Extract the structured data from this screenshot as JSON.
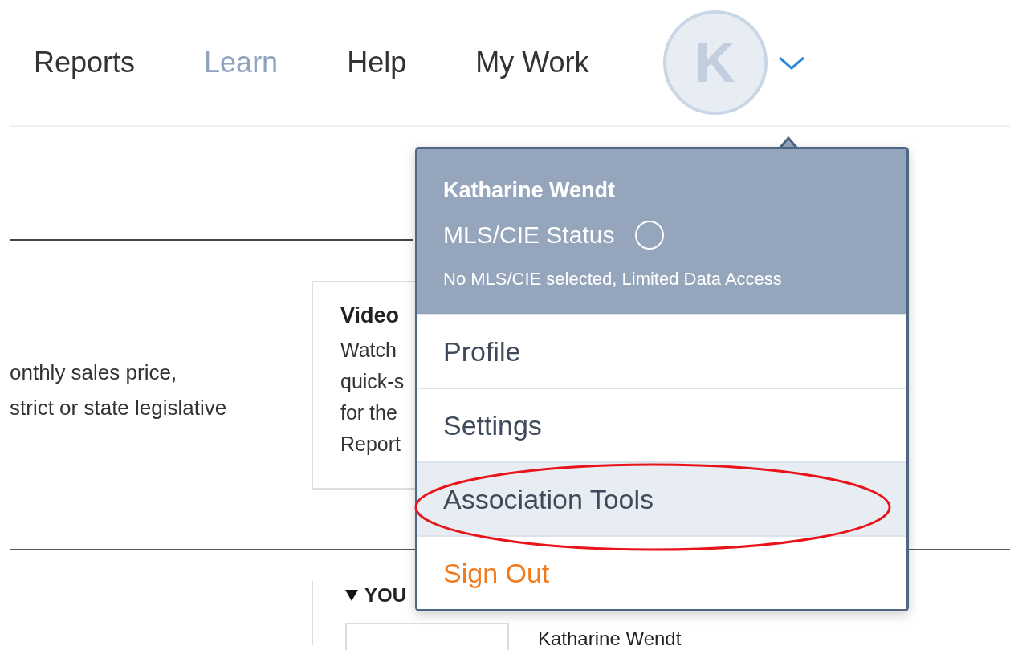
{
  "nav": {
    "items": [
      {
        "label": "Reports",
        "selected": false
      },
      {
        "label": "Learn",
        "selected": true
      },
      {
        "label": "Help",
        "selected": false
      },
      {
        "label": "My Work",
        "selected": false
      }
    ],
    "avatar": {
      "initial": "K",
      "expanded": true
    }
  },
  "intro": {
    "lines": [
      "onthly sales price,",
      "strict or state legislative"
    ]
  },
  "video_card": {
    "title": "Video",
    "lines": [
      "Watch",
      "quick-s",
      "for the",
      "Report"
    ]
  },
  "section": {
    "heading": "YOU",
    "expanded": true,
    "name": "Katharine Wendt"
  },
  "user_menu": {
    "name": "Katharine Wendt",
    "status_label": "MLS/CIE Status",
    "status_on": false,
    "note": "No MLS/CIE selected, Limited Data Access",
    "items": [
      {
        "label": "Profile",
        "kind": "normal",
        "selected": false,
        "annotated": false
      },
      {
        "label": "Settings",
        "kind": "normal",
        "selected": false,
        "annotated": false
      },
      {
        "label": "Association Tools",
        "kind": "normal",
        "selected": true,
        "annotated": true
      },
      {
        "label": "Sign Out",
        "kind": "danger",
        "selected": false,
        "annotated": false
      }
    ]
  }
}
